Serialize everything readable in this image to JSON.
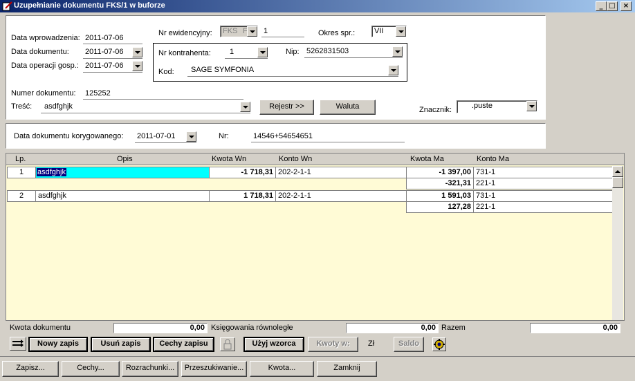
{
  "window": {
    "title": "Uzupełnianie dokumentu FKS/1 w buforze",
    "controls": {
      "minimize": "_",
      "maximize": "□",
      "close": "×"
    }
  },
  "header": {
    "data_wprowadzenia_label": "Data wprowadzenia:",
    "data_wprowadzenia": "2011-07-06",
    "data_dokumentu_label": "Data dokumentu:",
    "data_dokumentu": "2011-07-06",
    "data_operacji_label": "Data operacji gosp.:",
    "data_operacji": "2011-07-06",
    "nr_ewidencyjny_label": "Nr ewidencyjny:",
    "nr_ewidencyjny_prefix": "FKS",
    "nr_ewidencyjny_sub": "F",
    "nr_ewidencyjny": "1",
    "okres_label": "Okres spr.:",
    "okres": "VII",
    "nr_kontrahenta_label": "Nr kontrahenta:",
    "nr_kontrahenta": "1",
    "nip_label": "Nip:",
    "nip": "5262831503",
    "kod_label": "Kod:",
    "kod": "SAGE SYMFONIA",
    "numer_dokumentu_label": "Numer dokumentu:",
    "numer_dokumentu": "125252",
    "tresc_label": "Treść:",
    "tresc": "asdfghjk",
    "rejestr_button": "Rejestr >>",
    "waluta_button": "Waluta",
    "znacznik_label": "Znacznik:",
    "znacznik": ".puste"
  },
  "correction": {
    "data_label": "Data dokumentu korygowanego:",
    "data": "2011-07-01",
    "nr_label": "Nr:",
    "nr": "14546+54654651"
  },
  "grid": {
    "columns": {
      "lp": "Lp.",
      "opis": "Opis",
      "kwota_wn": "Kwota  Wn",
      "konto_wn": "Konto  Wn",
      "kwota_ma": "Kwota Ma",
      "konto_ma": "Konto Ma"
    },
    "rows": [
      {
        "lp": "1",
        "opis": "asdfghjk",
        "kwota_wn": "-1 718,31",
        "konto_wn": "202-2-1-1",
        "ma": [
          {
            "kwota": "-1 397,00",
            "konto": "731-1"
          },
          {
            "kwota": "-321,31",
            "konto": "221-1"
          }
        ]
      },
      {
        "lp": "2",
        "opis": "asdfghjk",
        "kwota_wn": "1 718,31",
        "konto_wn": "202-2-1-1",
        "ma": [
          {
            "kwota": "1 591,03",
            "konto": "731-1"
          },
          {
            "kwota": "127,28",
            "konto": "221-1"
          }
        ]
      }
    ]
  },
  "totals": {
    "kwota_dokumentu_label": "Kwota dokumentu",
    "kwota_dokumentu": "0,00",
    "ksiegowania_label": "Księgowania równoległe",
    "ksiegowania": "0,00",
    "razem_label": "Razem",
    "razem": "0,00"
  },
  "toolbar": {
    "nowy_zapis": "Nowy zapis",
    "usun_zapis": "Usuń zapis",
    "cechy_zapisu": "Cechy zapisu",
    "uzyj_wzorca": "Użyj wzorca",
    "kwoty_w": "Kwoty w:",
    "currency": "Zł",
    "saldo": "Saldo"
  },
  "footer": {
    "zapisz": "Zapisz...",
    "cechy": "Cechy...",
    "rozrachunki": "Rozrachunki...",
    "przeszukiwanie": "Przeszukiwanie...",
    "kwota": "Kwota...",
    "zamknij": "Zamknij"
  },
  "colors": {
    "title_start": "#0a246a",
    "title_end": "#a6caf0",
    "selection": "#00ffff",
    "grid_bg": "#fffbd6"
  }
}
